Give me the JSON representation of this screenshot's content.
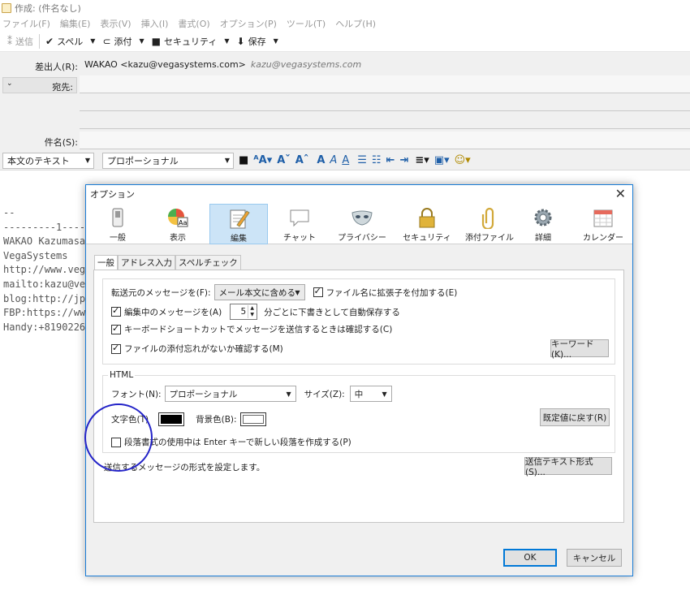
{
  "window": {
    "title": "作成: (件名なし)"
  },
  "menu": [
    "ファイル(F)",
    "編集(E)",
    "表示(V)",
    "挿入(I)",
    "書式(O)",
    "オプション(P)",
    "ツール(T)",
    "ヘルプ(H)"
  ],
  "toolbar": {
    "send": "送信",
    "spell": "スペル",
    "attach": "添付",
    "security": "セキュリティ",
    "save": "保存"
  },
  "headers": {
    "from_label": "差出人(R):",
    "from_value": "WAKAO <kazu@vegasystems.com>",
    "from_identity": "kazu@vegasystems.com",
    "to_label": "宛先:",
    "subject_label": "件名(S):"
  },
  "format": {
    "paragraph": "本文のテキスト",
    "font": "プロポーショナル"
  },
  "body_lines": [
    "--",
    "---------1----",
    "WAKAO Kazumasa",
    "VegaSystems",
    "http://www.veg",
    "mailto:kazu@ve",
    "blog:http://jp",
    "FBP:https://ww",
    "Handy:+8190226"
  ],
  "dialog": {
    "title": "オプション",
    "categories": [
      "一般",
      "表示",
      "編集",
      "チャット",
      "プライバシー",
      "セキュリティ",
      "添付ファイル",
      "詳細",
      "カレンダー"
    ],
    "tabs": [
      "一般",
      "アドレス入力",
      "スペルチェック"
    ],
    "forward_label": "転送元のメッセージを(F):",
    "forward_value": "メール本文に含める",
    "add_ext": "ファイル名に拡張子を付加する(E)",
    "autosave": "編集中のメッセージを(A)",
    "autosave_minutes": "5",
    "autosave_suffix": "分ごとに下書きとして自動保存する",
    "shortcut_confirm": "キーボードショートカットでメッセージを送信するときは確認する(C)",
    "attach_reminder": "ファイルの添付忘れがないか確認する(M)",
    "keyword_btn": "キーワード(K)...",
    "html_group": "HTML",
    "font_label": "フォント(N):",
    "font_value": "プロポーショナル",
    "size_label": "サイズ(Z):",
    "size_value": "中",
    "text_color_label": "文字色(T)",
    "bg_color_label": "背景色(B):",
    "reset_btn": "既定値に戻す(R)",
    "paragraph_opt": "段落書式の使用中は Enter キーで新しい段落を作成する(P)",
    "send_format_desc": "送信するメッセージの形式を設定します。",
    "send_format_btn": "送信テキスト形式(S)...",
    "ok": "OK",
    "cancel": "キャンセル"
  },
  "colors": {
    "text_color": "#000000",
    "bg_color": "#ffffff",
    "accent": "#0078d7",
    "annotation_circle": "#2424c8"
  }
}
